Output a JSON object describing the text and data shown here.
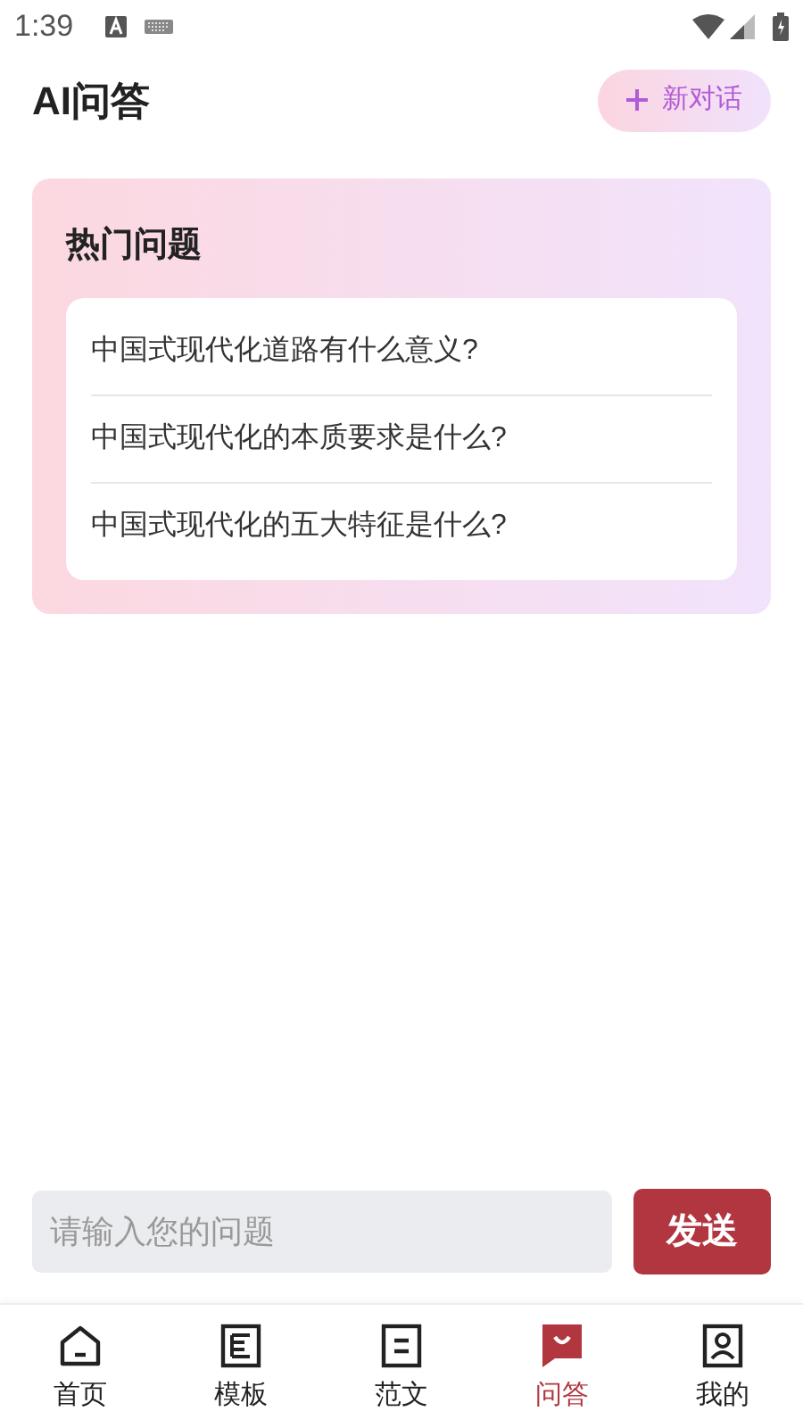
{
  "status_bar": {
    "time": "1:39"
  },
  "header": {
    "title": "AI问答",
    "new_chat_button": "新对话"
  },
  "hot_questions": {
    "title": "热门问题",
    "items": [
      {
        "text": "中国式现代化道路有什么意义?"
      },
      {
        "text": "中国式现代化的本质要求是什么?"
      },
      {
        "text": "中国式现代化的五大特征是什么?"
      }
    ]
  },
  "input": {
    "placeholder": "请输入您的问题",
    "send_button": "发送"
  },
  "tab_bar": [
    {
      "label": "首页",
      "kind": "home",
      "selected": false
    },
    {
      "label": "模板",
      "kind": "template",
      "selected": false
    },
    {
      "label": "范文",
      "kind": "doc",
      "selected": false
    },
    {
      "label": "问答",
      "kind": "chat",
      "selected": true
    },
    {
      "label": "我的",
      "kind": "profile",
      "selected": false
    }
  ]
}
